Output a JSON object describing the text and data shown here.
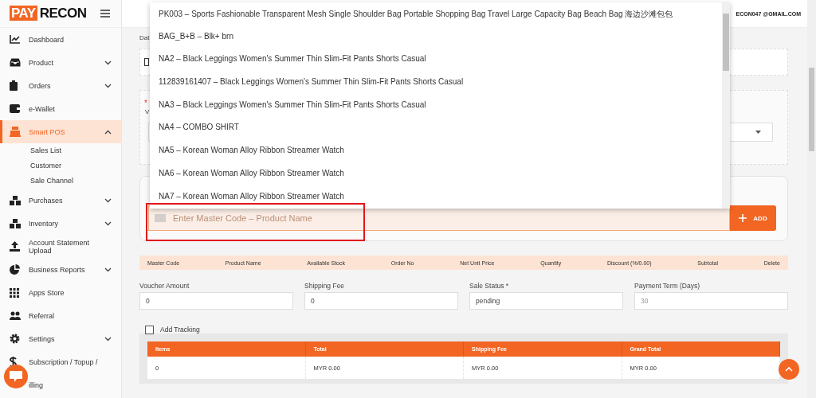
{
  "brand": {
    "logo_part_1": "PAY",
    "logo_part_2": "RECON"
  },
  "sidebar": {
    "items": [
      {
        "label": "Dashboard",
        "selected": false
      },
      {
        "label": "Product",
        "expanded": false,
        "selected": false
      },
      {
        "label": "Orders",
        "expanded": false,
        "selected": false
      },
      {
        "label": "e-Wallet",
        "selected": false
      },
      {
        "label": "Smart POS",
        "expanded": true,
        "selected": true,
        "children": [
          {
            "label": "Sales List"
          },
          {
            "label": "Customer"
          },
          {
            "label": "Sale Channel"
          }
        ]
      },
      {
        "label": "Purchases",
        "expanded": false,
        "selected": false
      },
      {
        "label": "Inventory",
        "expanded": false,
        "selected": false
      },
      {
        "label": "Account Statement Upload",
        "selected": false
      },
      {
        "label": "Business Reports",
        "expanded": false,
        "selected": false
      },
      {
        "label": "Apps Store",
        "selected": false
      },
      {
        "label": "Referral",
        "selected": false
      },
      {
        "label": "Settings",
        "expanded": false,
        "selected": false
      },
      {
        "label": "Subscription / Topup /",
        "selected": false
      },
      {
        "label": "illing",
        "selected": false
      }
    ]
  },
  "header": {
    "user_email": "ECON047 @GMAIL.COM"
  },
  "form": {
    "date_label": "Dat",
    "required_mark": "*",
    "warehouse_label": "V"
  },
  "product_search": {
    "placeholder": "Enter Master Code – Product Name",
    "add_button": "ADD",
    "suggestions": [
      "PK003 – Sports Fashionable Transparent Mesh Single Shoulder Bag Portable Shopping Bag Travel Large Capacity Bag Beach Bag 海边沙滩包包",
      "BAG_B+B – Blk+ brn",
      "NA2 – Black Leggings Women's Summer Thin Slim-Fit Pants Shorts Casual",
      "112839161407 – Black Leggings Women's Summer Thin Slim-Fit Pants Shorts Casual",
      "NA3 – Black Leggings Women's Summer Thin Slim-Fit Pants Shorts Casual",
      "NA4 – COMBO SHIRT",
      "NA5 – Korean Woman Alloy Ribbon Streamer Watch",
      "NA6 – Korean Woman Alloy Ribbon Streamer Watch",
      "NA7 – Korean Woman Alloy Ribbon Streamer Watch"
    ]
  },
  "items_table": {
    "columns": [
      "Master Code",
      "Product Name",
      "Available Stock",
      "Order No",
      "Net Unit Price",
      "Quantity",
      "Discount (%/0.00)",
      "Subtotal",
      "Delete"
    ]
  },
  "fields": [
    {
      "label": "Voucher Amount",
      "value": "0"
    },
    {
      "label": "Shipping Fee",
      "value": "0"
    },
    {
      "label": "Sale Status *",
      "value": "pending"
    },
    {
      "label": "Payment Term (Days)",
      "placeholder": "30"
    }
  ],
  "add_tracking": {
    "label": "Add Tracking",
    "checked": false
  },
  "summary": {
    "columns": [
      "Items",
      "Total",
      "Shipping Fee",
      "Grand Total"
    ],
    "rows": [
      [
        "0",
        "MYR 0.00",
        "MYR 0.00",
        "MYR 0.00"
      ]
    ]
  }
}
